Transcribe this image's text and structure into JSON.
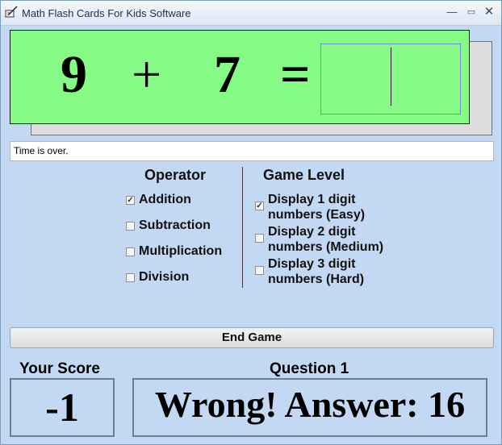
{
  "window": {
    "title": "Math Flash Cards For Kids Software",
    "controls": {
      "minimize": "—",
      "maximize": "▭",
      "close": "✕"
    }
  },
  "card": {
    "operand1": "9",
    "operator": "+",
    "operand2": "7",
    "equals": "=",
    "answer": ""
  },
  "status": "Time is over.",
  "operator_section": {
    "title": "Operator",
    "options": [
      {
        "label": "Addition",
        "checked": true
      },
      {
        "label": "Subtraction",
        "checked": false
      },
      {
        "label": "Multiplication",
        "checked": false
      },
      {
        "label": "Division",
        "checked": false
      }
    ]
  },
  "level_section": {
    "title": "Game Level",
    "options": [
      {
        "line1": "Display 1 digit",
        "line2": "numbers (Easy)",
        "checked": true
      },
      {
        "line1": "Display 2 digit",
        "line2": "numbers (Medium)",
        "checked": false
      },
      {
        "line1": "Display 3 digit",
        "line2": "numbers (Hard)",
        "checked": false
      }
    ]
  },
  "end_button": "End Game",
  "score": {
    "label": "Your Score",
    "value": "-1"
  },
  "question": {
    "label": "Question 1",
    "result": "Wrong! Answer: 16"
  },
  "colors": {
    "card": "#85fa85",
    "window_bg": "#c3d9f3",
    "card_shadow": "#dddddd"
  }
}
